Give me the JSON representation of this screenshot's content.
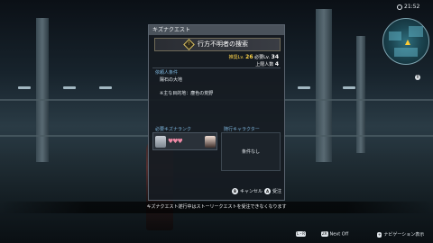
{
  "hud": {
    "time": "21:52",
    "minimap_button": "R"
  },
  "dialog": {
    "title": "キズナクエスト",
    "quest_icon": "!",
    "quest_name": "行方不明者の捜索",
    "stats": {
      "difficulty_label": "推奨Lv.",
      "difficulty_value": "26",
      "required_label": "必要Lv.",
      "required_value": "34",
      "limit_label": "上限人数",
      "limit_value": "4"
    },
    "requester_label": "依頼人条件",
    "requester_name": "陽石の大地",
    "target_note": "※主な目的地：塵色の荒野",
    "kizuna_rank_label": "必要キズナランク",
    "hearts": "♥♥♥",
    "follow_label": "随行キャラクター",
    "condition_value": "条件なし",
    "buttons": {
      "cancel_glyph": "B",
      "cancel_label": "キャンセル",
      "accept_glyph": "A",
      "accept_label": "受注"
    }
  },
  "notice": "キズナクエスト遂行中はストーリークエストを受注できなくなります",
  "hints": {
    "left_glyph": "L・R",
    "next_glyph": "ZR",
    "next_label": "Next Off",
    "nav_glyph": "+",
    "nav_label": "ナビゲーション表示"
  },
  "colors": {
    "accent_gold": "#ffd54a",
    "section_blue": "#7fb8e0",
    "heart_pink": "#f08aa6"
  }
}
